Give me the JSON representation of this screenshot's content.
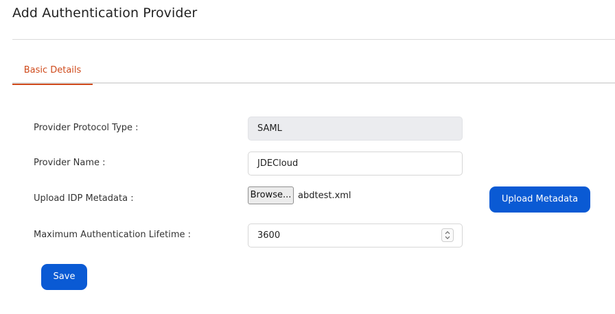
{
  "header": {
    "title": "Add Authentication Provider"
  },
  "tabs": [
    {
      "label": "Basic Details",
      "active": true
    }
  ],
  "form": {
    "protocol_type": {
      "label": "Provider Protocol Type :",
      "value": "SAML"
    },
    "provider_name": {
      "label": "Provider Name :",
      "value": "JDECloud"
    },
    "idp_metadata": {
      "label": "Upload IDP Metadata :",
      "browse_label": "Browse...",
      "file_name": "abdtest.xml",
      "upload_label": "Upload Metadata"
    },
    "auth_lifetime": {
      "label": "Maximum Authentication Lifetime :",
      "value": "3600"
    }
  },
  "actions": {
    "save_label": "Save"
  },
  "colors": {
    "accent_tab": "#cf4a1b",
    "primary_button": "#0a5ad4",
    "readonly_field": "#ebecef"
  }
}
